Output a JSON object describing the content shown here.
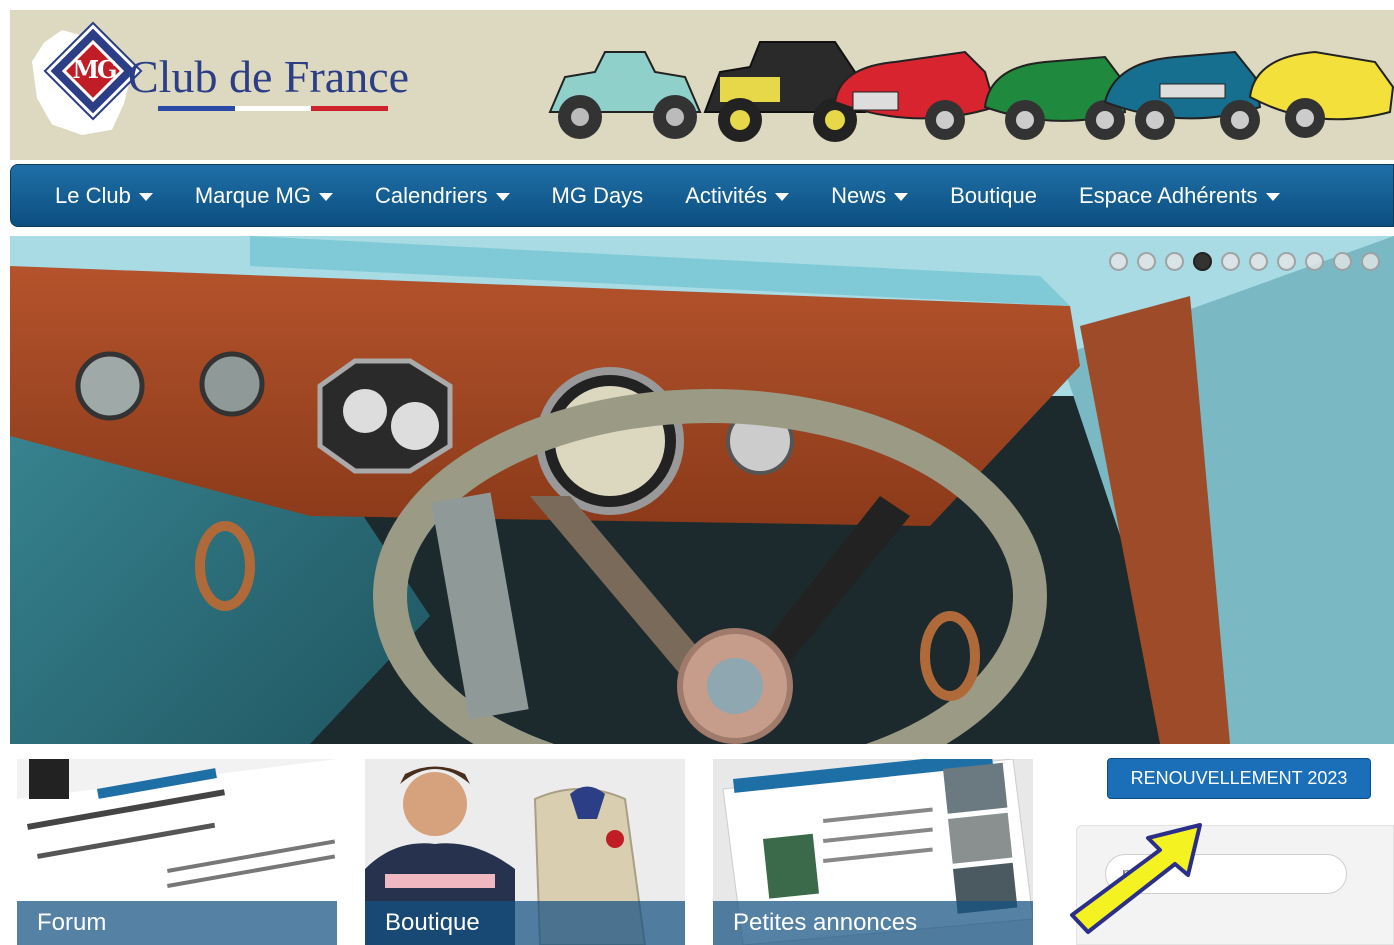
{
  "header": {
    "logo_text": "Club de France",
    "logo_badge": "MG"
  },
  "nav": {
    "items": [
      {
        "label": "Le Club",
        "dropdown": true
      },
      {
        "label": "Marque MG",
        "dropdown": true
      },
      {
        "label": "Calendriers",
        "dropdown": true
      },
      {
        "label": "MG Days",
        "dropdown": false
      },
      {
        "label": "Activités",
        "dropdown": true
      },
      {
        "label": "News",
        "dropdown": true
      },
      {
        "label": "Boutique",
        "dropdown": false
      },
      {
        "label": "Espace Adhérents",
        "dropdown": true
      }
    ]
  },
  "slider": {
    "dot_count": 10,
    "active_index": 3
  },
  "tiles": [
    {
      "label": "Forum"
    },
    {
      "label": "Boutique"
    },
    {
      "label": "Petites annonces"
    }
  ],
  "sidebar": {
    "renew_button": "RENOUVELLEMENT 2023",
    "search_placeholder": "me..."
  },
  "colors": {
    "header_bg": "#dcd9c0",
    "nav_bg": "#1f6fa7",
    "brand_blue": "#2b3e86",
    "brand_red": "#c01d26",
    "button_blue": "#1a6fb8",
    "arrow_yellow": "#f5f222"
  },
  "icons": [
    "caret-down-icon",
    "mg-logo-icon",
    "annotation-arrow-icon"
  ]
}
